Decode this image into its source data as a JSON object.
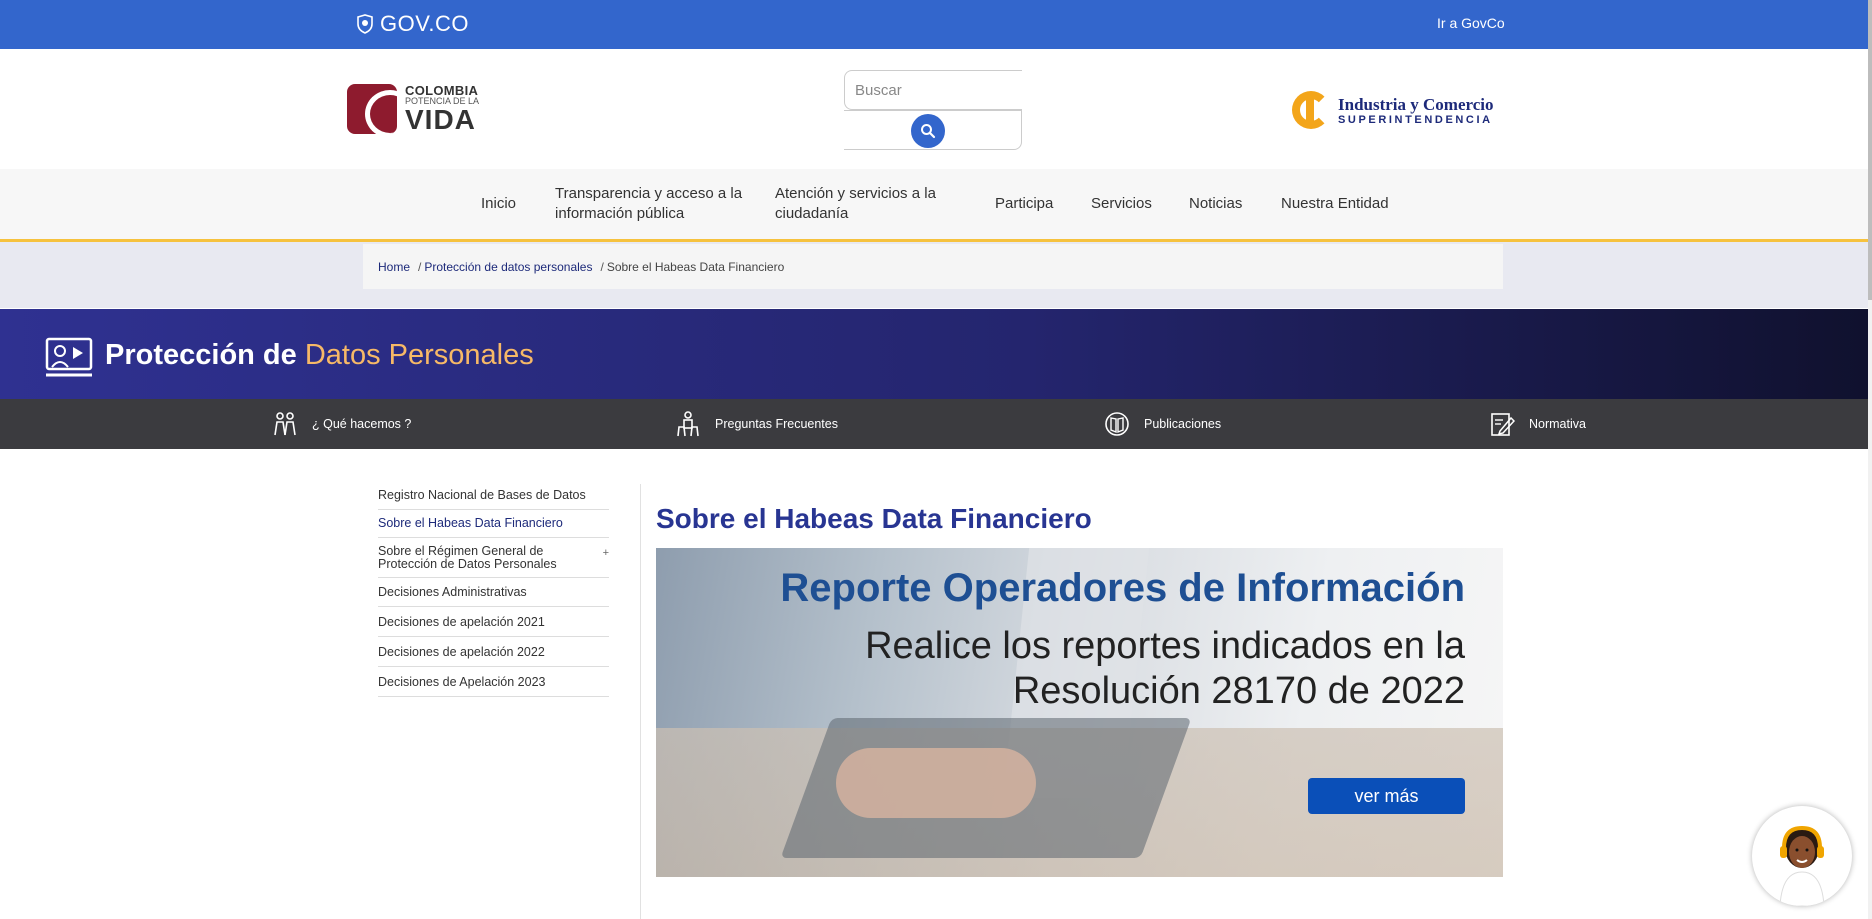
{
  "govbar": {
    "logo_text": "GOV.CO",
    "link": "Ir a GovCo",
    "bg_color": "#3366cc"
  },
  "header": {
    "colombia_logo": {
      "line1": "COLOMBIA",
      "line2": "POTENCIA DE LA",
      "line3": "VIDA"
    },
    "search": {
      "placeholder": "Buscar",
      "value": "",
      "button_icon": "search-icon"
    },
    "sic_logo": {
      "line1": "Industria y Comercio",
      "line2": "SUPERINTENDENCIA"
    }
  },
  "nav": {
    "items": [
      {
        "label": "Inicio"
      },
      {
        "label": "Transparencia y acceso a la información pública"
      },
      {
        "label": "Atención y servicios a la ciudadanía"
      },
      {
        "label": "Participa"
      },
      {
        "label": "Servicios"
      },
      {
        "label": "Noticias"
      },
      {
        "label": "Nuestra Entidad"
      }
    ]
  },
  "breadcrumb": {
    "items": [
      "Home",
      "Protección de datos personales",
      "Sobre el Habeas Data Financiero"
    ],
    "separator": "/"
  },
  "banner": {
    "title_bold": "Protección de",
    "title_highlight": "Datos Personales",
    "icon": "presentation-icon",
    "highlight_color": "#f7b967"
  },
  "subnav": {
    "items": [
      {
        "label": "¿ Qué hacemos ?",
        "icon": "people-icon"
      },
      {
        "label": "Preguntas Frecuentes",
        "icon": "question-people-icon"
      },
      {
        "label": "Publicaciones",
        "icon": "book-icon"
      },
      {
        "label": "Normativa",
        "icon": "edit-document-icon"
      }
    ]
  },
  "sidebar": {
    "items": [
      {
        "label": "Registro Nacional de Bases de Datos"
      },
      {
        "label": "Sobre el Habeas Data Financiero",
        "active": true
      },
      {
        "label": "Sobre el Régimen General de Protección de Datos Personales",
        "expandable": "+"
      },
      {
        "label": "Decisiones Administrativas"
      },
      {
        "label": "Decisiones de apelación 2021"
      },
      {
        "label": "Decisiones de apelación 2022"
      },
      {
        "label": "Decisiones de Apelación 2023"
      }
    ]
  },
  "main": {
    "title": "Sobre el Habeas Data Financiero",
    "hero": {
      "heading": "Reporte Operadores de Información",
      "subheading": "Realice los reportes indicados en la Resolución 28170 de 2022",
      "button": "ver más"
    }
  },
  "assistant": {
    "icon": "assistant-avatar-icon"
  }
}
